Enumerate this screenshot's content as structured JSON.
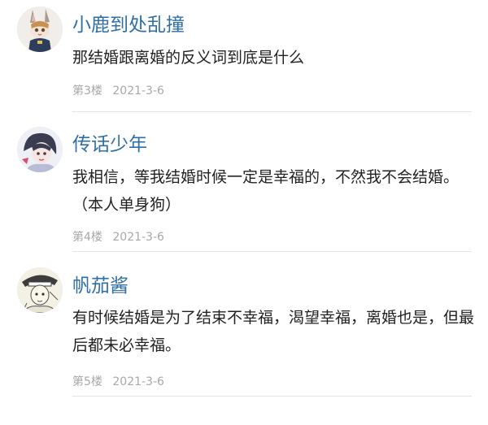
{
  "comments": [
    {
      "username": "小鹿到处乱撞",
      "avatar_icon": "avatar-bunny-cop-icon",
      "lines": [
        "那结婚跟离婚的反义词到底是什么"
      ],
      "floor": "第3楼",
      "date": "2021-3-6"
    },
    {
      "username": "传话少年",
      "avatar_icon": "avatar-anime-boy-icon",
      "lines": [
        "我相信，等我结婚时候一定是幸福的，不然我不会结婚。",
        "（本人单身狗）"
      ],
      "floor": "第4楼",
      "date": "2021-3-6"
    },
    {
      "username": "帆茄酱",
      "avatar_icon": "avatar-sketch-girl-icon",
      "lines": [
        "有时候结婚是为了结束不幸福，渴望幸福，离婚也是，但最",
        "后都未必幸福。"
      ],
      "floor": "第5楼",
      "date": "2021-3-6"
    }
  ],
  "colors": {
    "username": "#2f6fa7",
    "text": "#222222",
    "meta": "#a8a8a8",
    "divider": "#e4e4e4"
  }
}
